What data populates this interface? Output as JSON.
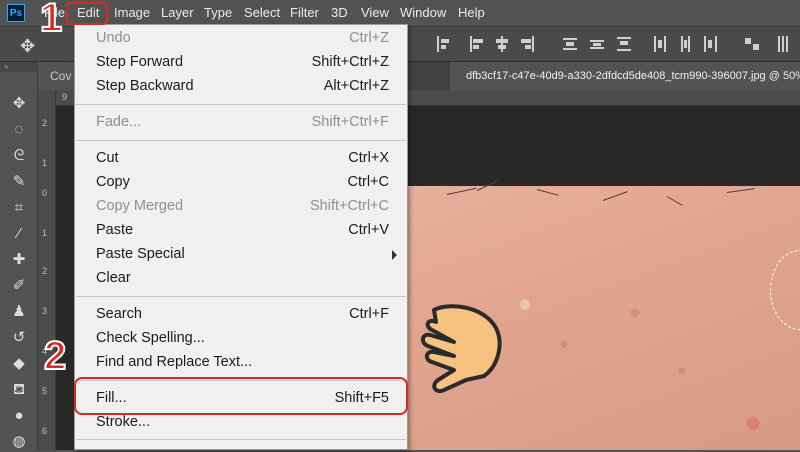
{
  "menubar": {
    "logo": "Ps",
    "items": [
      "File",
      "Edit",
      "Image",
      "Layer",
      "Type",
      "Select",
      "Filter",
      "3D",
      "View",
      "Window",
      "Help"
    ]
  },
  "tabs": {
    "first": "Cov",
    "active": "dfb3cf17-c47e-40d9-a330-2dfdcd5de408_tcm990-396007.jpg @ 50% (RG"
  },
  "ruler": {
    "vertical": [
      "2",
      "1",
      "0",
      "1",
      "2",
      "3",
      "4",
      "5",
      "6"
    ],
    "horizontal": [
      "9"
    ]
  },
  "edit_menu": {
    "items": [
      {
        "label": "Undo",
        "shortcut": "Ctrl+Z",
        "disabled": true
      },
      {
        "label": "Step Forward",
        "shortcut": "Shift+Ctrl+Z",
        "disabled": false
      },
      {
        "label": "Step Backward",
        "shortcut": "Alt+Ctrl+Z",
        "disabled": false
      },
      {
        "label": "Fade...",
        "shortcut": "Shift+Ctrl+F",
        "disabled": true
      },
      {
        "label": "Cut",
        "shortcut": "Ctrl+X",
        "disabled": false
      },
      {
        "label": "Copy",
        "shortcut": "Ctrl+C",
        "disabled": false
      },
      {
        "label": "Copy Merged",
        "shortcut": "Shift+Ctrl+C",
        "disabled": true
      },
      {
        "label": "Paste",
        "shortcut": "Ctrl+V",
        "disabled": false
      },
      {
        "label": "Paste Special",
        "shortcut": "",
        "disabled": false
      },
      {
        "label": "Clear",
        "shortcut": "",
        "disabled": false
      },
      {
        "label": "Search",
        "shortcut": "Ctrl+F",
        "disabled": false
      },
      {
        "label": "Check Spelling...",
        "shortcut": "",
        "disabled": false
      },
      {
        "label": "Find and Replace Text...",
        "shortcut": "",
        "disabled": false
      },
      {
        "label": "Fill...",
        "shortcut": "Shift+F5",
        "disabled": false
      },
      {
        "label": "Stroke...",
        "shortcut": "",
        "disabled": false
      }
    ]
  },
  "annotations": {
    "step1": "1",
    "step2": "2"
  },
  "colors": {
    "accent": "#d82a22",
    "menu_bg": "#f0f0f0",
    "app_bg": "#535353"
  },
  "icons": [
    "move-icon",
    "marquee-icon",
    "lasso-icon",
    "quick-select-icon",
    "crop-icon",
    "eyedropper-icon",
    "healing-brush-icon",
    "brush-icon",
    "clone-stamp-icon",
    "history-brush-icon",
    "eraser-icon",
    "paint-bucket-icon",
    "blur-icon",
    "dodge-icon",
    "pointing-hand-icon"
  ]
}
